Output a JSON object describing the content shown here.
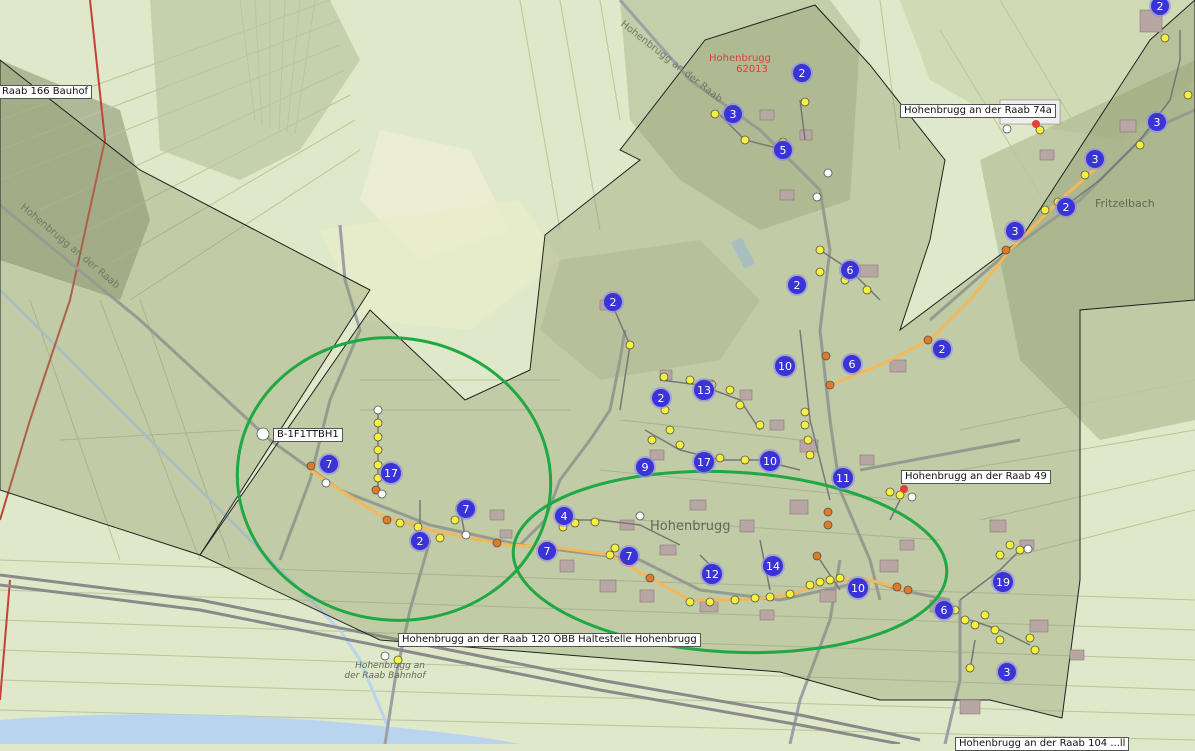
{
  "colors": {
    "land": "#dfe8c8",
    "parcel_line": "#b9c5a2",
    "polygon_fill": "#8a9468",
    "polygon_line": "#222222",
    "ellipse": "#1fa844",
    "fiber_route": "#f2b85a",
    "yellow_node": "#f6f23c",
    "orange_node": "#e07a2a",
    "cluster_badge": "#3a33d6",
    "road": "#9aa0a6",
    "rail": "#8a8a8a",
    "river": "#b9d4ef",
    "building": "#b8a6a4",
    "muni_line": "#c0443a",
    "place_label": "#d9413a"
  },
  "map_labels": {
    "raab_bauhof": "Raab 166 Bauhof",
    "b1f1": "B-1F1TTBH1",
    "raab74a": "Hohenbrugg an der Raab 74a",
    "raab49": "Hohenbrugg an der Raab 49",
    "raab120": "Hohenbrugg an der Raab 120 ÖBB Haltestelle Hohenbrugg",
    "bottom_cut": "Hohenbrugg an der Raab 104 ...ll"
  },
  "place_names": {
    "hohenbrugg": "Hohenbrugg",
    "code": "62013",
    "hohenbrugg_village": "Hohenbrugg",
    "bahnhof1": "Hohenbrugg an",
    "bahnhof2": "der Raab Bahnhof",
    "fritzelbach": "Fritzelbach",
    "road_left": "Hohenbrugg an der Raab",
    "road_top": "Hohenbrugg an der Raab"
  },
  "clusters": [
    "2",
    "2",
    "3",
    "5",
    "3",
    "3",
    "2",
    "3",
    "2",
    "6",
    "2",
    "2",
    "10",
    "6",
    "2",
    "13",
    "9",
    "17",
    "10",
    "7",
    "17",
    "7",
    "2",
    "4",
    "7",
    "7",
    "12",
    "14",
    "10",
    "6",
    "19",
    "3",
    "11"
  ]
}
